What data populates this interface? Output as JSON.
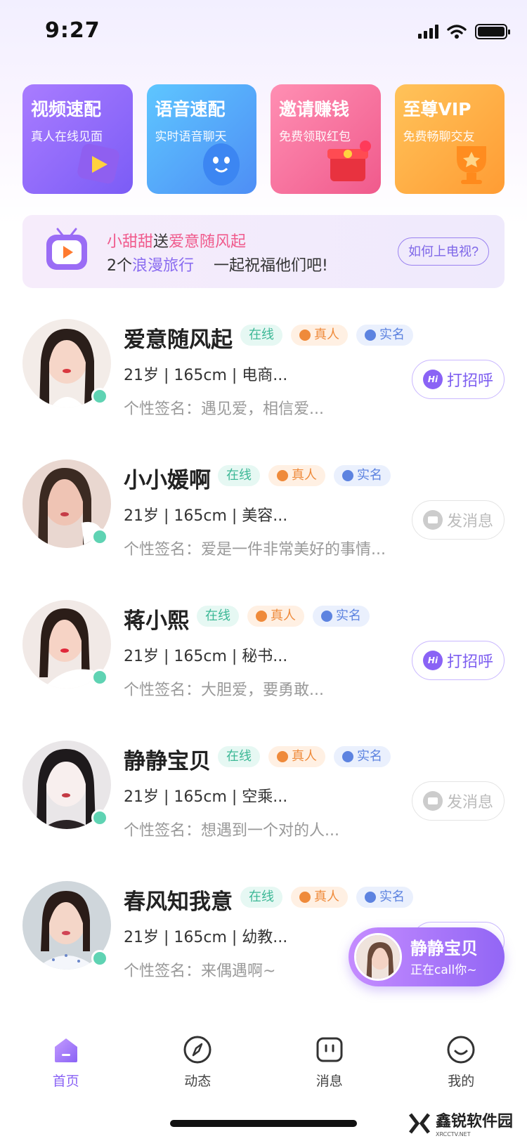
{
  "status": {
    "time": "9:27"
  },
  "cards": [
    {
      "title": "视频速配",
      "subtitle": "真人在线见面",
      "icon": "play-video-icon"
    },
    {
      "title": "语音速配",
      "subtitle": "实时语音聊天",
      "icon": "blob-mascot-icon"
    },
    {
      "title": "邀请赚钱",
      "subtitle": "免费领取红包",
      "icon": "red-envelope-icon"
    },
    {
      "title": "至尊VIP",
      "subtitle": "免费畅聊交友",
      "icon": "trophy-icon"
    }
  ],
  "banner": {
    "sender": "小甜甜",
    "send_word": "送",
    "recipient": "爱意随风起",
    "gift_count": "2个",
    "gift_name": "浪漫旅行",
    "blessing": "一起祝福他们吧!",
    "how_button": "如何上电视?"
  },
  "tags": {
    "online": "在线",
    "real": "真人",
    "verified": "实名"
  },
  "users": [
    {
      "name": "爱意随风起",
      "info": "21岁 | 165cm | 电商...",
      "signature": "个性签名：遇见爱，相信爱...",
      "action": "打招呼",
      "action_type": "greet"
    },
    {
      "name": "小小媛啊",
      "info": "21岁 | 165cm | 美容...",
      "signature": "个性签名：爱是一件非常美好的事情...",
      "action": "发消息",
      "action_type": "message"
    },
    {
      "name": "蒋小熙",
      "info": "21岁 | 165cm | 秘书...",
      "signature": "个性签名：大胆爱，要勇敢...",
      "action": "打招呼",
      "action_type": "greet"
    },
    {
      "name": "静静宝贝",
      "info": "21岁 | 165cm | 空乘...",
      "signature": "个性签名：想遇到一个对的人...",
      "action": "发消息",
      "action_type": "message"
    },
    {
      "name": "春风知我意",
      "info": "21岁 | 165cm | 幼教...",
      "signature": "个性签名：来偶遇啊~",
      "action": "",
      "action_type": "greet"
    }
  ],
  "call": {
    "name": "静静宝贝",
    "status": "正在call你~"
  },
  "tabs": [
    {
      "label": "首页",
      "icon": "home-icon",
      "active": true
    },
    {
      "label": "动态",
      "icon": "compass-icon",
      "active": false
    },
    {
      "label": "消息",
      "icon": "message-icon",
      "active": false
    },
    {
      "label": "我的",
      "icon": "smile-profile-icon",
      "active": false
    }
  ],
  "watermark": {
    "title": "鑫锐软件园",
    "sub": "XRCCTV.NET"
  },
  "colors": {
    "accent": "#8a63f5",
    "online": "#5fd3b3",
    "pink": "#f05a8c"
  }
}
